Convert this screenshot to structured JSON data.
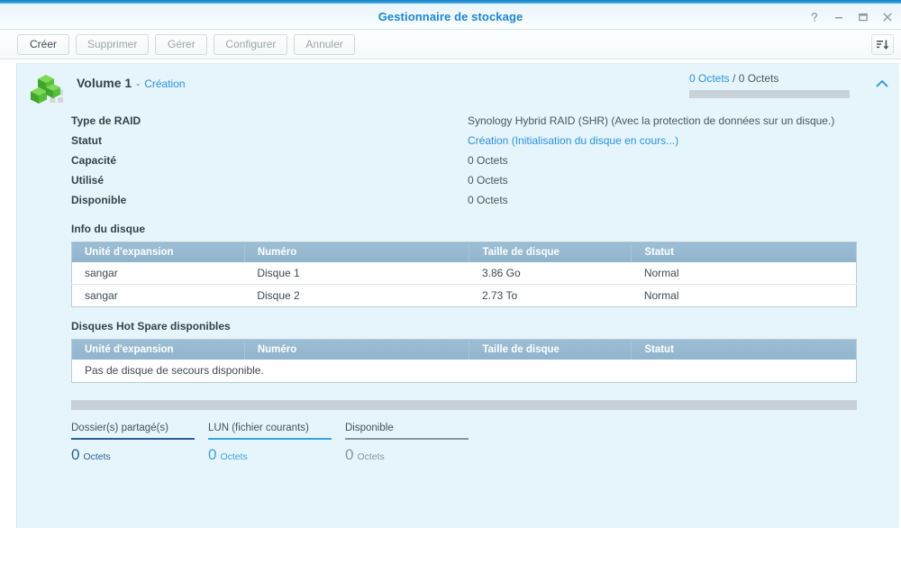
{
  "window": {
    "title": "Gestionnaire de stockage",
    "controls": [
      {
        "name": "help-icon",
        "label": "?"
      },
      {
        "name": "minimize-icon",
        "label": "−"
      },
      {
        "name": "maximize-icon",
        "label": "□"
      },
      {
        "name": "close-icon",
        "label": "×"
      }
    ]
  },
  "toolbar": {
    "buttons": [
      {
        "label": "Créer",
        "enabled": true
      },
      {
        "label": "Supprimer",
        "enabled": false
      },
      {
        "label": "Gérer",
        "enabled": false
      },
      {
        "label": "Configurer",
        "enabled": false
      },
      {
        "label": "Annuler",
        "enabled": false
      }
    ],
    "right_icon": "sort-descending-icon"
  },
  "volume": {
    "icon": "volume-cubes-icon",
    "title": "Volume 1",
    "separator": "-",
    "state": "Création",
    "capacity_used": "0 Octets",
    "capacity_divider": "/",
    "capacity_total": "0 Octets",
    "progress_percent": 0,
    "collapse_icon": "chevron-up-icon"
  },
  "details": [
    {
      "label": "Type de RAID",
      "value": "Synology Hybrid RAID (SHR) (Avec la protection de données sur un disque.)",
      "link": false
    },
    {
      "label": "Statut",
      "value": "Création (Initialisation du disque en cours...)",
      "link": true
    },
    {
      "label": "Capacité",
      "value": "0 Octets",
      "link": false
    },
    {
      "label": "Utilisé",
      "value": "0 Octets",
      "link": false
    },
    {
      "label": "Disponible",
      "value": "0 Octets",
      "link": false
    }
  ],
  "disk_info": {
    "title": "Info du disque",
    "columns": [
      "Unité d'expansion",
      "Numéro",
      "Taille de disque",
      "Statut"
    ],
    "rows": [
      {
        "unit": "sangar",
        "number": "Disque 1",
        "size": "3.86 Go",
        "status": "Normal"
      },
      {
        "unit": "sangar",
        "number": "Disque 2",
        "size": "2.73 To",
        "status": "Normal"
      }
    ]
  },
  "hot_spare": {
    "title": "Disques Hot Spare disponibles",
    "columns": [
      "Unité d'expansion",
      "Numéro",
      "Taille de disque",
      "Statut"
    ],
    "empty_message": "Pas de disque de secours disponible."
  },
  "usage": {
    "legend": [
      {
        "label": "Dossier(s) partagé(s)",
        "number": "0",
        "unit": "Octets",
        "color": "#2e5f94"
      },
      {
        "label": "LUN (fichier courants)",
        "number": "0",
        "unit": "Octets",
        "color": "#3aa3e0"
      },
      {
        "label": "Disponible",
        "number": "0",
        "unit": "Octets",
        "color": "#8b959c"
      }
    ]
  },
  "colors": {
    "accent_blue": "#2a93da",
    "title_blue": "#1b86cf",
    "panel_bg": "#e6f4fc",
    "table_header": "#8fb4cd",
    "status_green": "#2c9b27"
  }
}
